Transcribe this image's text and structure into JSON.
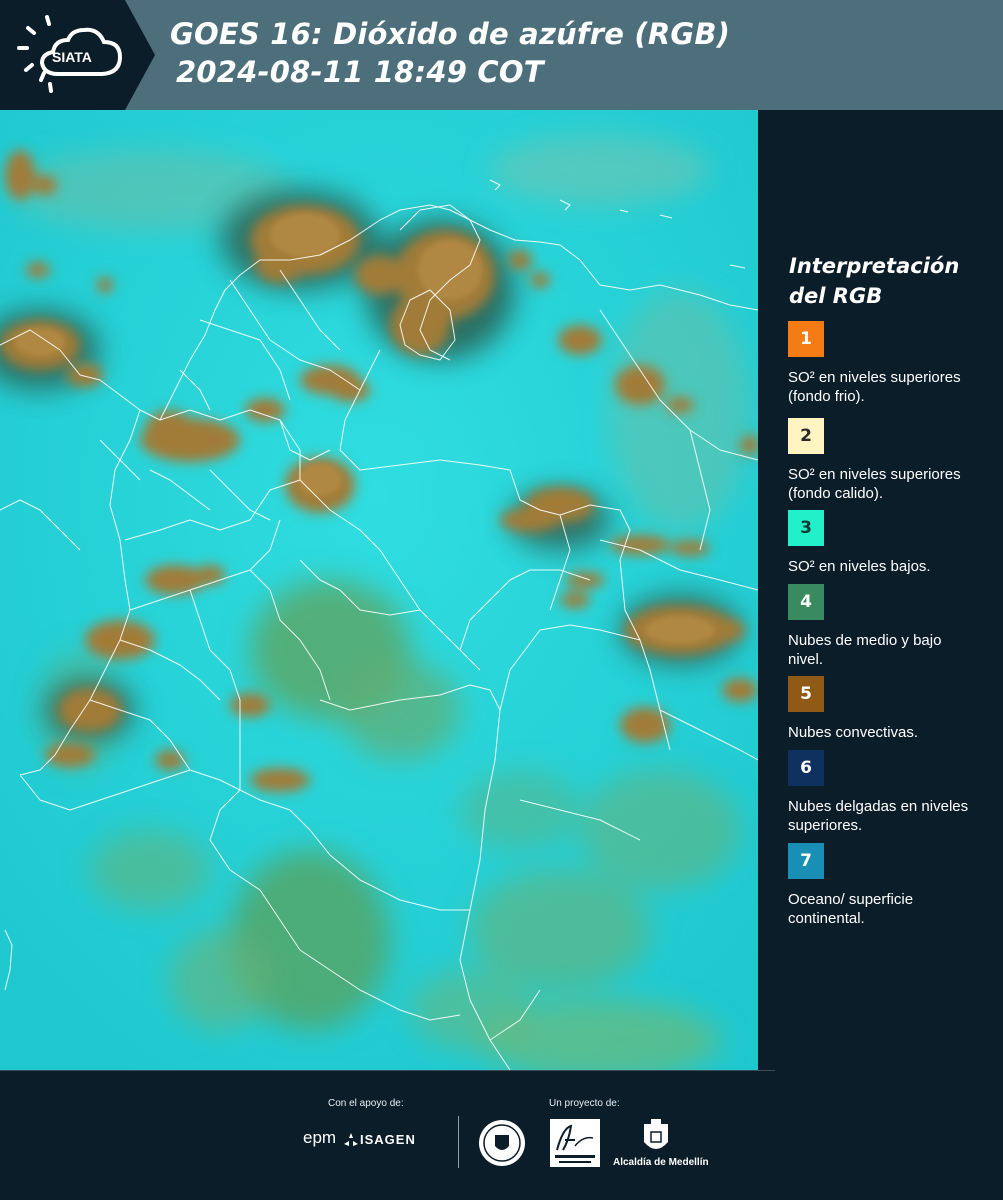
{
  "header": {
    "logo_text": "SIATA",
    "title_line1": "GOES 16: Dióxido de azúfre (RGB)",
    "title_line2": "2024-08-11 18:49 COT"
  },
  "legend": {
    "title": "Interpretación del RGB",
    "items": [
      {
        "number": "1",
        "color": "#f57c15",
        "text_color": "#ffffff",
        "text": "SO² en niveles superiores (fondo frio)."
      },
      {
        "number": "2",
        "color": "#fff4c2",
        "text_color": "#2a2a2a",
        "text": "SO² en niveles superiores (fondo calido)."
      },
      {
        "number": "3",
        "color": "#21f0c8",
        "text_color": "#0c3a36",
        "text": "SO² en niveles bajos."
      },
      {
        "number": "4",
        "color": "#3a8a60",
        "text_color": "#ffffff",
        "text": "Nubes de medio y bajo nivel."
      },
      {
        "number": "5",
        "color": "#8f5a16",
        "text_color": "#ffffff",
        "text": "Nubes convectivas."
      },
      {
        "number": "6",
        "color": "#0f3160",
        "text_color": "#ffffff",
        "text": "Nubes delgadas en niveles superiores."
      },
      {
        "number": "7",
        "color": "#1a8fb5",
        "text_color": "#ffffff",
        "text": "Oceano/ superficie continental."
      }
    ]
  },
  "footer": {
    "support_label": "Con el apoyo de:",
    "project_label": "Un proyecto de:",
    "sponsor_1": "epm",
    "sponsor_2": "ISAGEN",
    "partner_text": "Alcaldía de Medellín"
  },
  "colors": {
    "header_bg": "#4d6f7b",
    "panel_bg": "#0c1d2a",
    "map_background": "#1fd1d6",
    "convective_cloud": "#a07a36",
    "low_cloud": "#5cb890",
    "border_line": "#ffffff"
  }
}
